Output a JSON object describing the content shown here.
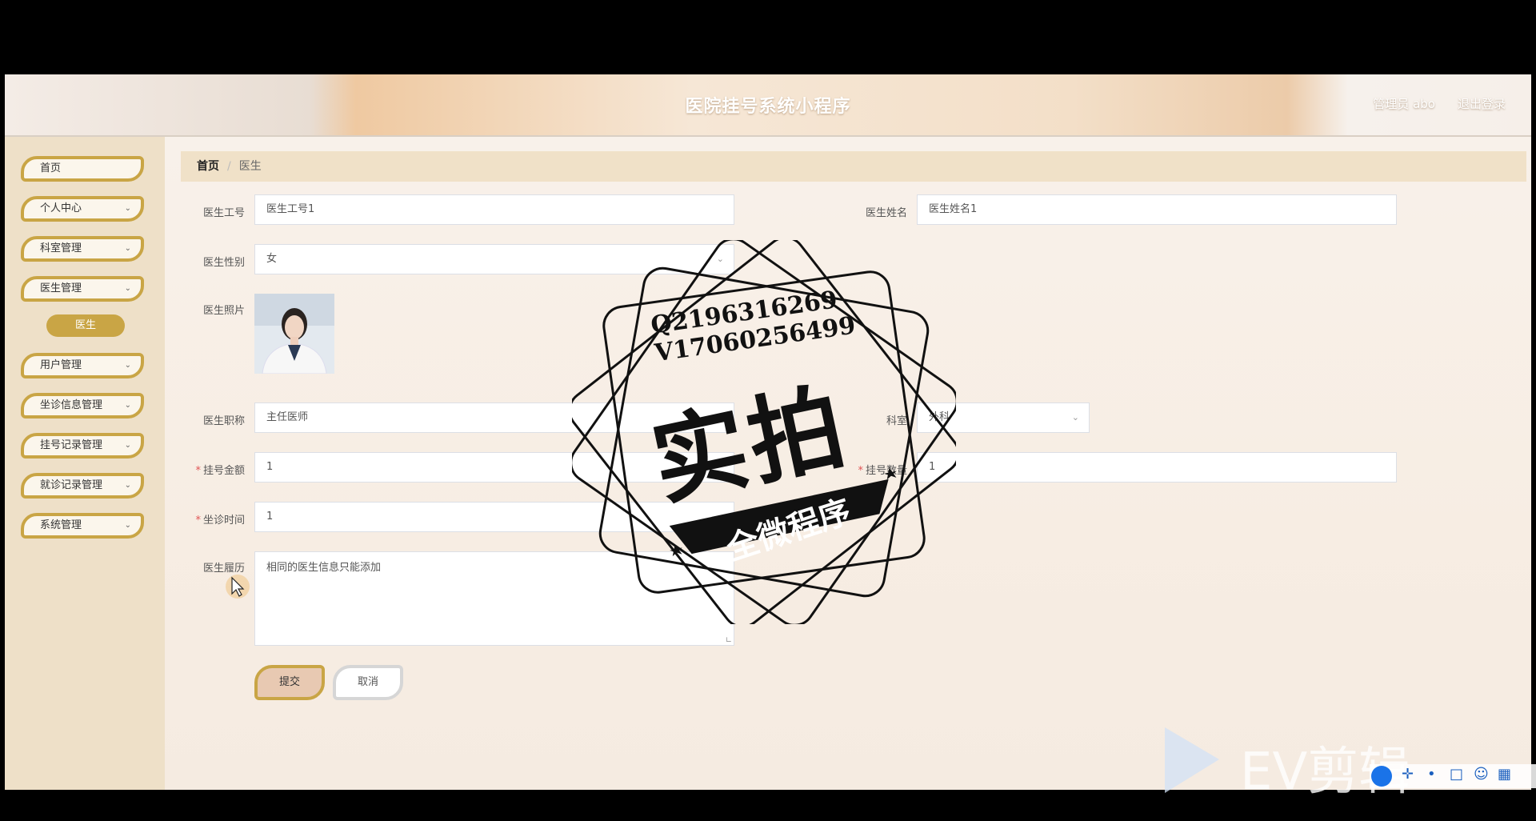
{
  "header": {
    "title": "医院挂号系统小程序",
    "user": "管理员 abo",
    "logout": "退出登录"
  },
  "sidebar": {
    "items": [
      {
        "label": "首页",
        "has_children": false
      },
      {
        "label": "个人中心",
        "has_children": true
      },
      {
        "label": "科室管理",
        "has_children": true
      },
      {
        "label": "医生管理",
        "has_children": true
      },
      {
        "label": "用户管理",
        "has_children": true
      },
      {
        "label": "坐诊信息管理",
        "has_children": true
      },
      {
        "label": "挂号记录管理",
        "has_children": true
      },
      {
        "label": "就诊记录管理",
        "has_children": true
      },
      {
        "label": "系统管理",
        "has_children": true
      }
    ],
    "active_sub": "医生"
  },
  "breadcrumb": {
    "home": "首页",
    "separator": "/",
    "current": "医生"
  },
  "form": {
    "doctor_id": {
      "label": "医生工号",
      "value": "医生工号1"
    },
    "doctor_name": {
      "label": "医生姓名",
      "value": "医生姓名1"
    },
    "gender": {
      "label": "医生性别",
      "value": "女"
    },
    "photo": {
      "label": "医生照片"
    },
    "title": {
      "label": "医生职称",
      "value": "主任医师"
    },
    "department": {
      "label": "科室",
      "value": "外科"
    },
    "fee": {
      "label": "挂号金额",
      "value": "1",
      "required": "*"
    },
    "quota": {
      "label": "挂号数量",
      "value": "1",
      "required": "*"
    },
    "duty_time": {
      "label": "坐诊时间",
      "value": "1",
      "required": "*"
    },
    "resume": {
      "label": "医生履历",
      "value": "相同的医生信息只能添加"
    },
    "submit": "提交",
    "cancel": "取消"
  },
  "watermark": {
    "qq": "Q2196316269",
    "vx": "V17060256499",
    "big": "实拍",
    "banner": "全微程序",
    "ev": "EV剪辑"
  },
  "colors": {
    "accent": "#c9a545",
    "sidebar_bg": "#eee0c8",
    "breadcrumb_bg": "#f0e1c8"
  }
}
